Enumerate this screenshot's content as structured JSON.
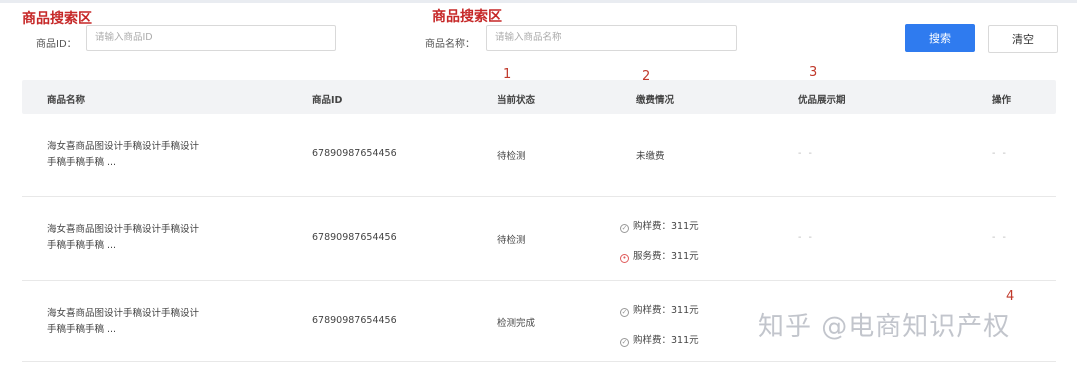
{
  "annotations": {
    "search_area_1": "商品搜索区",
    "search_area_2": "商品搜索区",
    "num1": "1",
    "num2": "2",
    "num3": "3",
    "num4": "4"
  },
  "search": {
    "id_label": "商品ID：",
    "id_placeholder": "请输入商品ID",
    "name_label": "商品名称：",
    "name_placeholder": "请输入商品名称",
    "search_button": "搜索",
    "clear_button": "清空"
  },
  "table": {
    "headers": [
      "商品名称",
      "商品ID",
      "当前状态",
      "缴费情况",
      "优品展示期",
      "操作"
    ],
    "rows": [
      {
        "name_line1": "海女喜商品图设计手稿设计手稿设计",
        "name_line2": "手稿手稿手稿 ...",
        "id": "67890987654456",
        "status": "待检测",
        "fee": "未缴费",
        "display_period": "- -",
        "action": "- -"
      },
      {
        "name_line1": "海女喜商品图设计手稿设计手稿设计",
        "name_line2": "手稿手稿手稿 ...",
        "id": "67890987654456",
        "status": "待检测",
        "fees": [
          "购样费：311元",
          "服务费：311元"
        ],
        "display_period": "- -",
        "action": "- -"
      },
      {
        "name_line1": "海女喜商品图设计手稿设计手稿设计",
        "name_line2": "手稿手稿手稿 ...",
        "id": "67890987654456",
        "status": "检测完成",
        "fees": [
          "购样费：311元",
          "购样费：311元"
        ]
      }
    ]
  },
  "watermark": "知乎 @电商知识产权",
  "colors": {
    "primary": "#2f7bef",
    "annotation": "#c62828",
    "header_bg": "#f2f3f5"
  }
}
